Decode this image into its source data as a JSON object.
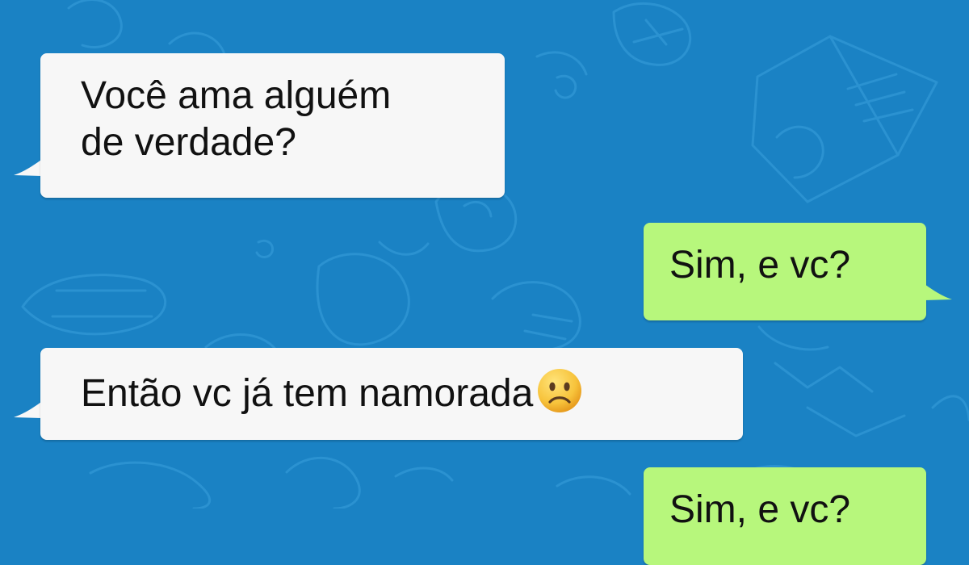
{
  "chat": {
    "messages": [
      {
        "direction": "incoming",
        "lines": [
          "Você ama alguém",
          "de verdade?"
        ]
      },
      {
        "direction": "outgoing",
        "text": "Sim, e vc?"
      },
      {
        "direction": "incoming",
        "text": "Então vc já tem namorada",
        "emoji": "slightly-frowning-face-icon"
      },
      {
        "direction": "outgoing",
        "text": "Sim, e vc?"
      }
    ]
  },
  "colors": {
    "background": "#1a82c4",
    "doodle": "#2b92d1",
    "incoming_bubble": "#f7f7f7",
    "outgoing_bubble": "#b7f77c",
    "text": "#111111"
  }
}
